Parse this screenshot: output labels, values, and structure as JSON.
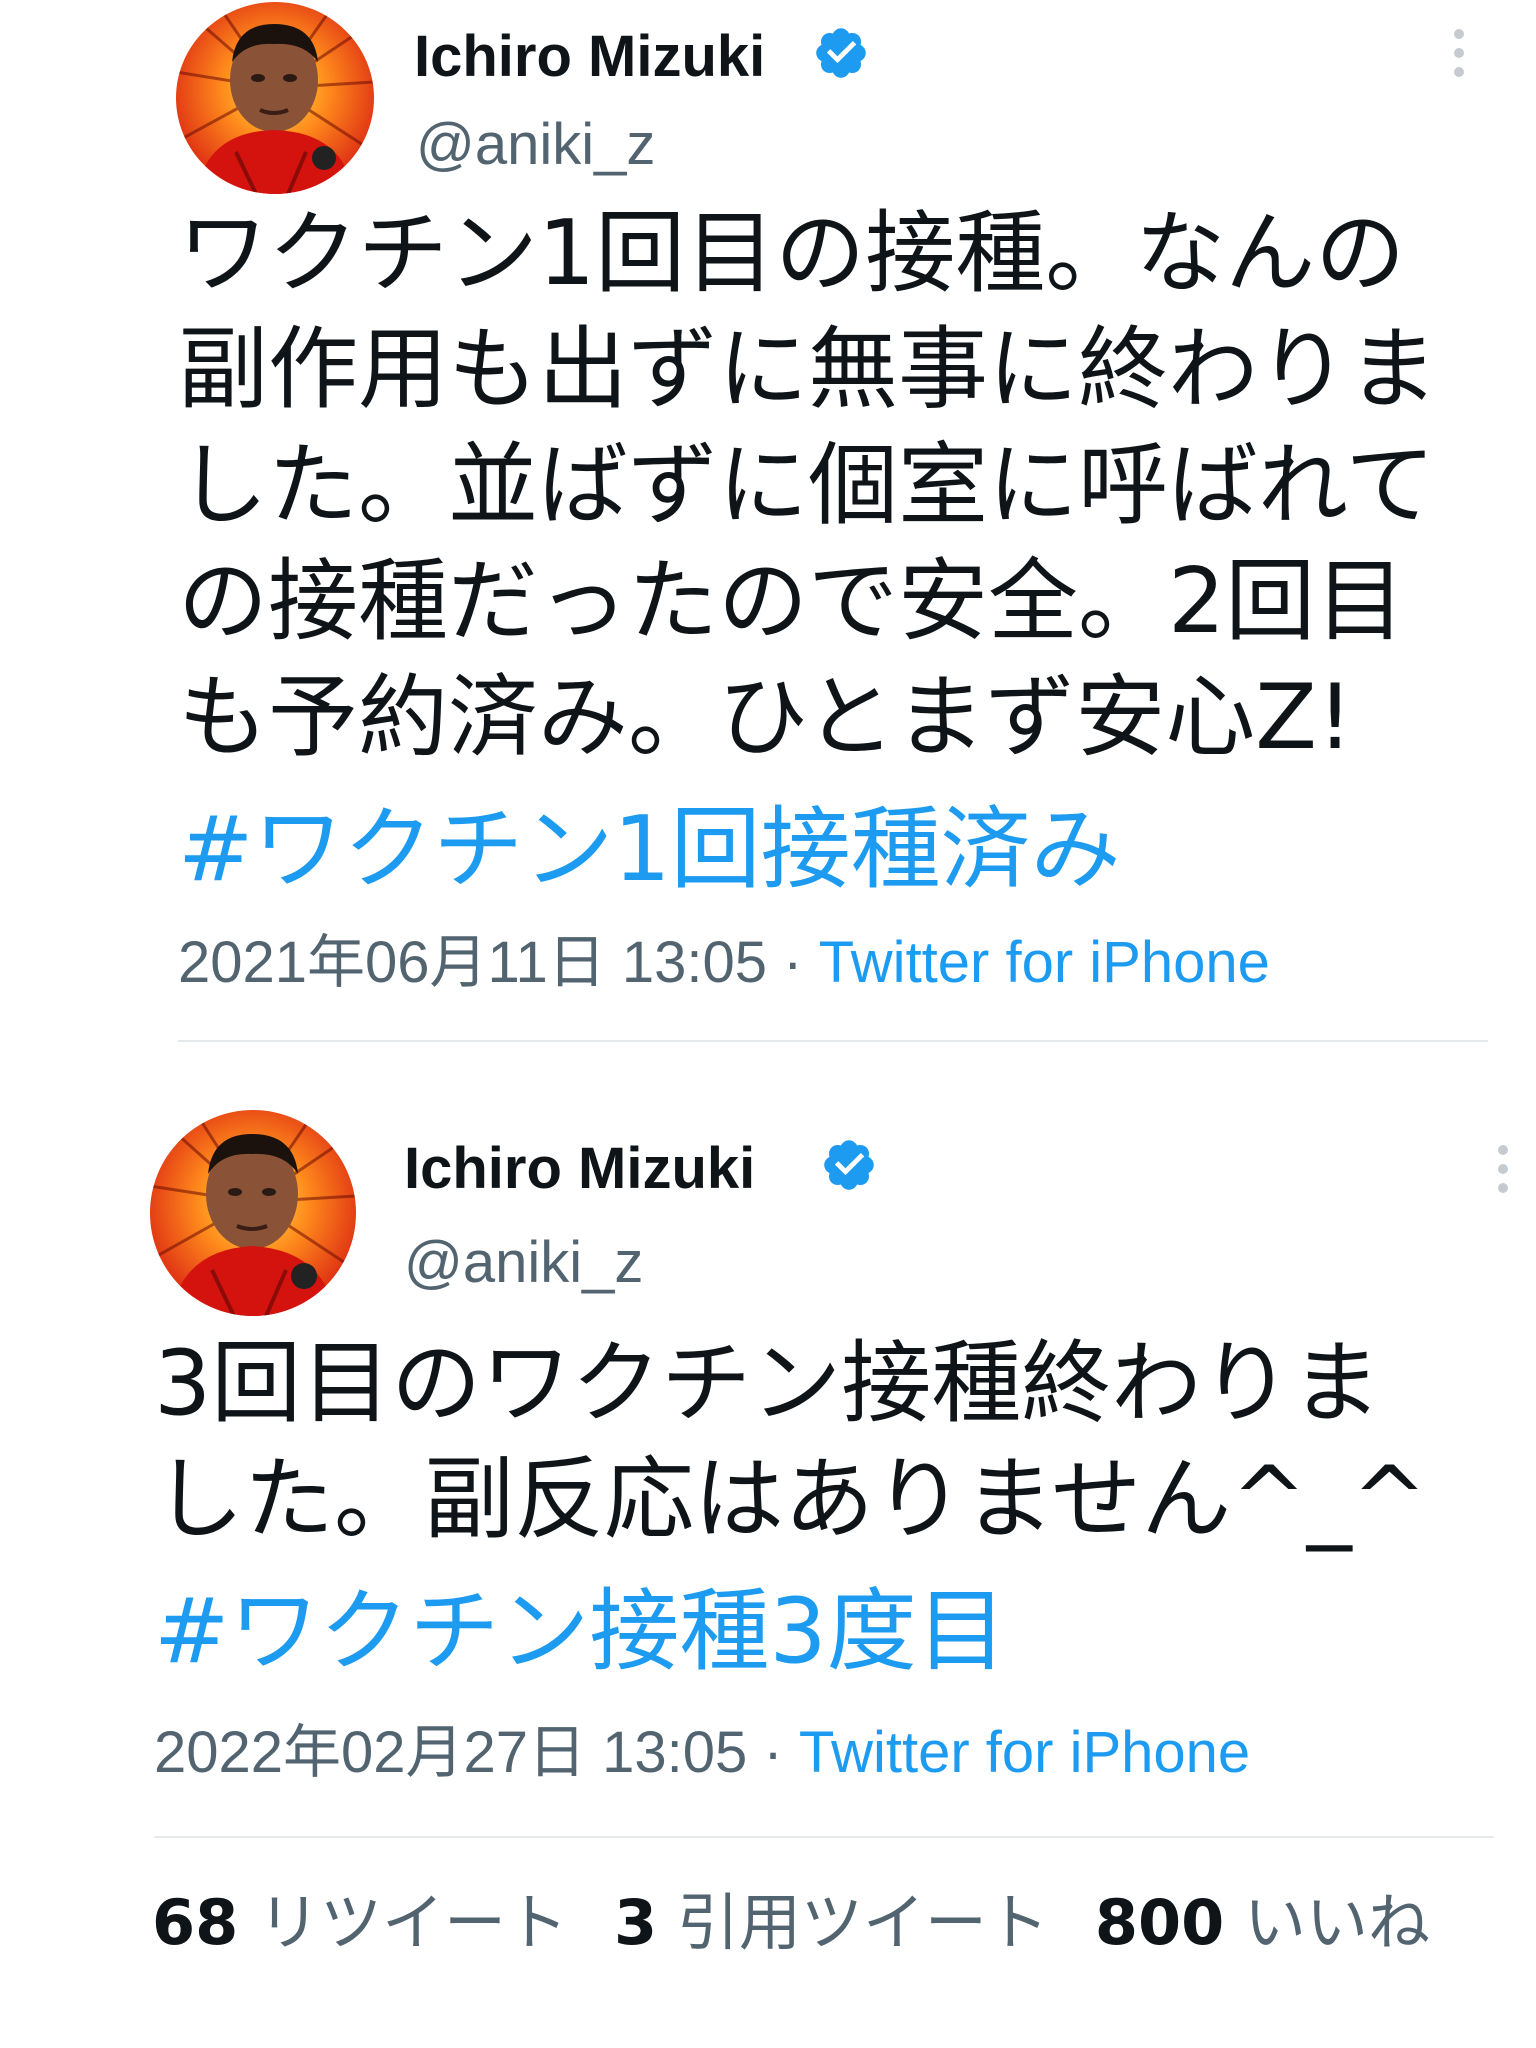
{
  "colors": {
    "text": "#0f1419",
    "secondary": "#536471",
    "link": "#1d9bf0",
    "verified": "#1d9bf0",
    "divider": "#e6e9eb"
  },
  "tweets": [
    {
      "display_name": "Ichiro Mizuki",
      "handle": "@aniki_z",
      "verified_icon": "verified-badge-icon",
      "body": "ワクチン1回目の接種。なんの\n副作用も出ずに無事に終わりま\nした。並ばずに個室に呼ばれて\nの接種だったので安全。2回目\nも予約済み。ひとまず安心Z!",
      "hashtag": "#ワクチン1回接種済み",
      "timestamp": "2021年06月11日 13:05",
      "separator": " · ",
      "source": "Twitter for iPhone"
    },
    {
      "display_name": "Ichiro Mizuki",
      "handle": "@aniki_z",
      "verified_icon": "verified-badge-icon",
      "body": "3回目のワクチン接種終わりま\nした。副反応はありません^_^",
      "hashtag": "#ワクチン接種3度目",
      "timestamp": "2022年02月27日 13:05",
      "separator": " · ",
      "source": "Twitter for iPhone"
    }
  ],
  "stats": {
    "retweets_count": "68",
    "retweets_label": "リツイート",
    "quotes_count": "3",
    "quotes_label": "引用ツイート",
    "likes_count": "800",
    "likes_label": "いいね"
  }
}
